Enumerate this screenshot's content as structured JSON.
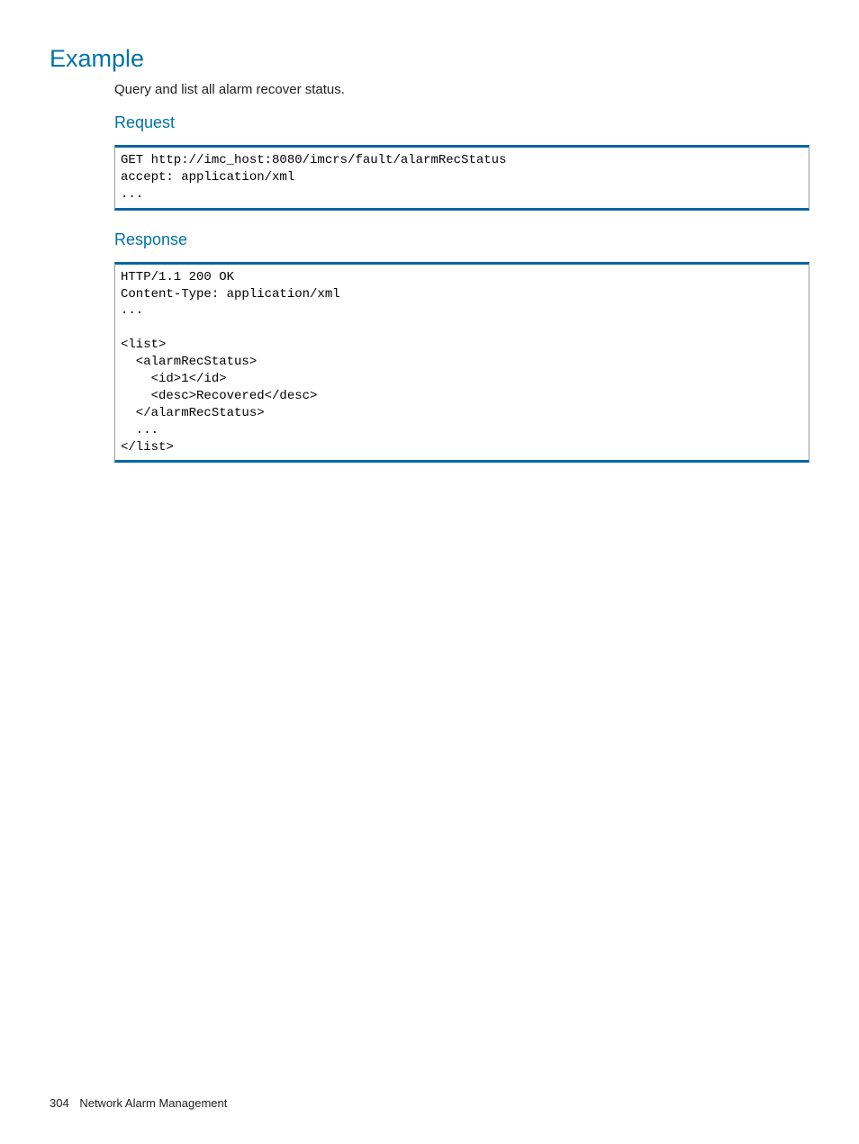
{
  "headings": {
    "example": "Example",
    "request": "Request",
    "response": "Response"
  },
  "description": "Query and list all alarm recover status.",
  "request_code": "GET http://imc_host:8080/imcrs/fault/alarmRecStatus\naccept: application/xml\n...",
  "response_code": "HTTP/1.1 200 OK\nContent-Type: application/xml\n...\n\n<list>\n  <alarmRecStatus>\n    <id>1</id>\n    <desc>Recovered</desc>\n  </alarmRecStatus>\n  ...\n</list>",
  "footer": {
    "page_number": "304",
    "section": "Network Alarm Management"
  }
}
